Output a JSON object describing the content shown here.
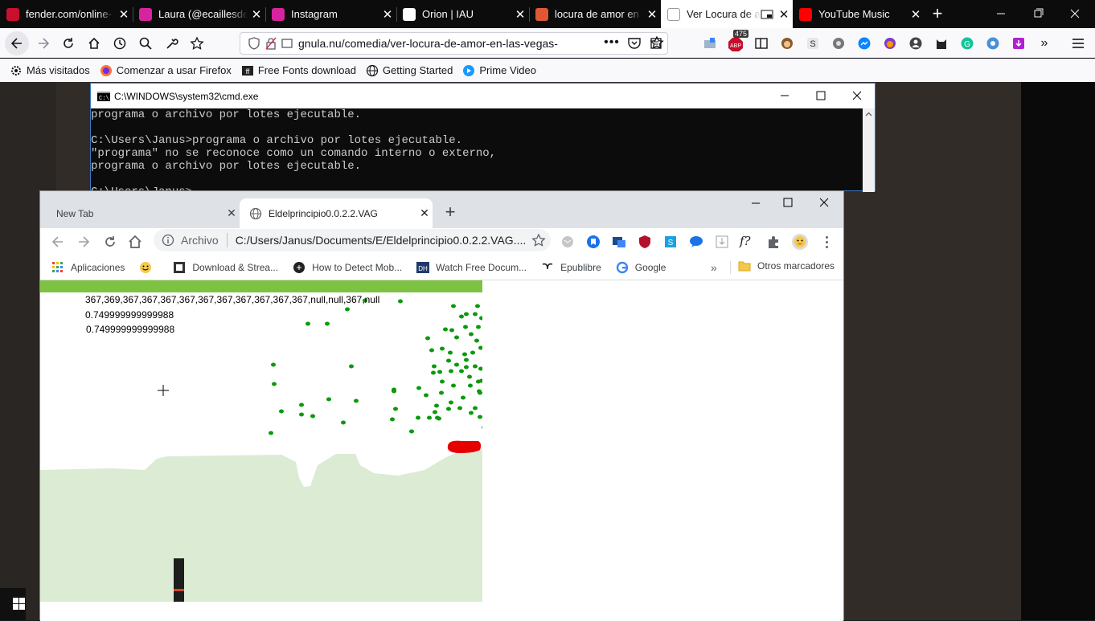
{
  "firefox": {
    "tabs": [
      {
        "title": "fender.com/online-",
        "icon": "fender-icon",
        "color": "#c8102e"
      },
      {
        "title": "Laura (@ecaillesdel",
        "icon": "instagram-icon",
        "color": "#d6249f"
      },
      {
        "title": "Instagram",
        "icon": "instagram-icon",
        "color": "#d6249f"
      },
      {
        "title": "Orion | IAU",
        "icon": "iau-icon",
        "color": "#ffffff"
      },
      {
        "title": "locura de amor en l",
        "icon": "duckduckgo-icon",
        "color": "#de5833"
      },
      {
        "title": "Ver Locura de amor",
        "icon": "gnula-icon",
        "color": "#ffffff"
      },
      {
        "title": "YouTube Music",
        "icon": "youtube-music-icon",
        "color": "#ff0000"
      }
    ],
    "url": "gnula.nu/comedia/ver-locura-de-amor-en-las-vegas-",
    "abp_badge": "475",
    "bookmarks": [
      {
        "label": "Más visitados",
        "icon": "gear-icon"
      },
      {
        "label": "Comenzar a usar Firefox",
        "icon": "firefox-icon"
      },
      {
        "label": "Free Fonts download",
        "icon": "fonts-icon"
      },
      {
        "label": "Getting Started",
        "icon": "globe-icon"
      },
      {
        "label": "Prime Video",
        "icon": "prime-video-icon"
      }
    ]
  },
  "cmd": {
    "title": "C:\\WINDOWS\\system32\\cmd.exe",
    "lines": [
      "programa o archivo por lotes ejecutable.",
      "",
      "C:\\Users\\Janus>programa o archivo por lotes ejecutable.",
      "\"programa\" no se reconoce como un comando interno o externo,",
      "programa o archivo por lotes ejecutable.",
      "",
      "C:\\Users\\Janus>"
    ]
  },
  "chrome": {
    "tabs": [
      {
        "title": "New Tab"
      },
      {
        "title": "Eldelprincipio0.0.2.2.VAG"
      }
    ],
    "omnibox_scheme": "Archivo",
    "omnibox_url": "C:/Users/Janus/Documents/E/Eldelprincipio0.0.2.2.VAG....",
    "bookmarks": [
      {
        "label": "Aplicaciones",
        "icon": "apps-grid-icon"
      },
      {
        "label": "",
        "icon": "smiley-icon"
      },
      {
        "label": "Download & Strea...",
        "icon": "download-icon"
      },
      {
        "label": "How to Detect Mob...",
        "icon": "detect-icon"
      },
      {
        "label": "Watch Free Docum...",
        "icon": "dh-icon"
      },
      {
        "label": "Epublibre",
        "icon": "epublibre-icon"
      },
      {
        "label": "Google",
        "icon": "google-icon"
      }
    ],
    "other_bookmarks": "Otros marcadores",
    "game": {
      "debug_lines": [
        "367,369,367,367,367,367,367,367,367,367,367,367,null,null,367,null",
        "0.749999999999988",
        "0.749999999999988"
      ],
      "colors": {
        "sky": "#ffffff",
        "ground": "#dcebd3",
        "topbar": "#7dc242",
        "particle": "#0a9a0a",
        "blob": "#e60000"
      }
    }
  }
}
